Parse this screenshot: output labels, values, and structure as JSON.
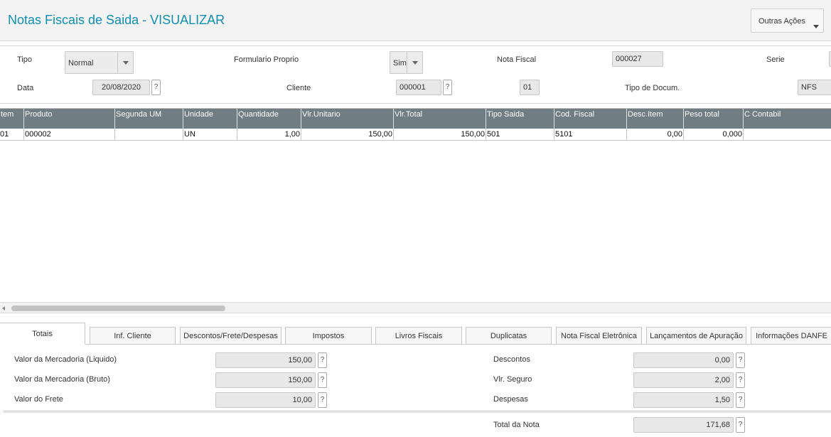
{
  "header": {
    "title": "Notas Fiscais de Saida - VISUALIZAR",
    "outras_acoes": "Outras Ações"
  },
  "form": {
    "tipo_label": "Tipo",
    "tipo_value": "Normal",
    "formulario_label": "Formulario Proprio",
    "formulario_value": "Sim",
    "nota_label": "Nota Fiscal",
    "nota_value": "000027",
    "serie_label": "Serie",
    "data_label": "Data",
    "data_value": "20/08/2020",
    "cliente_label": "Cliente",
    "cliente_value": "000001",
    "loja_value": "01",
    "tipodoc_label": "Tipo de Docum.",
    "tipodoc_value": "NFS",
    "help": "?"
  },
  "grid": {
    "columns": [
      "tem",
      "Produto",
      "Segunda UM",
      "Unidade",
      "Quantidade",
      "Vlr.Unitario",
      "Vlr.Total",
      "Tipo Saida",
      "Cod. Fiscal",
      "Desc.Item",
      "Peso total",
      "C Contabil"
    ],
    "rows": [
      [
        "01",
        "000002",
        "",
        "UN",
        "1,00",
        "150,00",
        "150,00",
        "501",
        "5101",
        "0,00",
        "0,000",
        ""
      ]
    ]
  },
  "tabs": [
    "Totais",
    "Inf. Cliente",
    "Descontos/Frete/Despesas",
    "Impostos",
    "Livros Fiscais",
    "Duplicatas",
    "Nota Fiscal Eletrônica",
    "Lançamentos de Apuração",
    "Informações DANFE"
  ],
  "totais": {
    "merc_liq_label": "Valor da Mercadoria (Liquido)",
    "merc_liq_value": "150,00",
    "merc_bruto_label": "Valor da Mercadoria (Bruto)",
    "merc_bruto_value": "150,00",
    "frete_label": "Valor do Frete",
    "frete_value": "10,00",
    "descontos_label": "Descontos",
    "descontos_value": "0,00",
    "seguro_label": "Vlr. Seguro",
    "seguro_value": "2,00",
    "despesas_label": "Despesas",
    "despesas_value": "1,50",
    "total_label": "Total da Nota",
    "total_value": "171,68"
  }
}
